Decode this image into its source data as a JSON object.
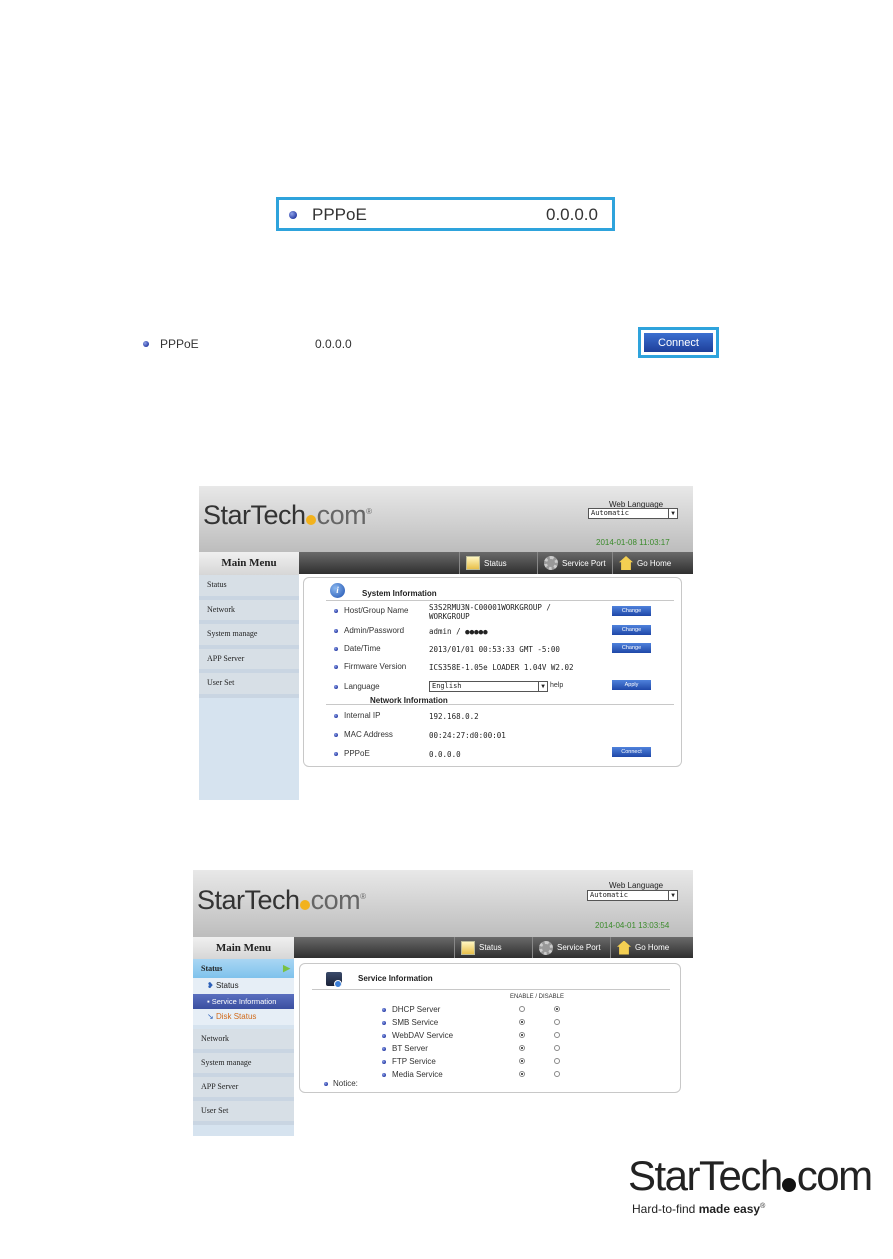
{
  "callout1": {
    "label": "PPPoE",
    "value": "0.0.0.0"
  },
  "callout2": {
    "label": "PPPoE",
    "value": "0.0.0.0",
    "button": "Connect"
  },
  "shot1": {
    "logo_main": "StarTech",
    "logo_com": "com",
    "web_language_label": "Web Language",
    "web_language_value": "Automatic",
    "datetime": "2014-01-08 11:03:17",
    "topnav": [
      "Status",
      "Service Port",
      "Go Home"
    ],
    "main_menu_title": "Main Menu",
    "main_menu": [
      "Status",
      "Network",
      "System manage",
      "APP Server",
      "User Set"
    ],
    "system_info_title": "System Information",
    "rows": [
      {
        "label": "Host/Group Name",
        "value": "S3S2RMU3N-C00001WORKGROUP / WORKGROUP",
        "button": "Change"
      },
      {
        "label": "Admin/Password",
        "value": "admin / ●●●●●",
        "button": "Change"
      },
      {
        "label": "Date/Time",
        "value": "2013/01/01 00:53:33 GMT -5:00",
        "button": "Change"
      },
      {
        "label": "Firmware Version",
        "value": "ICS358E-1.05e LOADER 1.04V W2.02",
        "button": ""
      },
      {
        "label": "Language",
        "value": "English",
        "button": "Apply",
        "suffix": "help"
      }
    ],
    "network_info_title": "Network Information",
    "net_rows": [
      {
        "label": "Internal IP",
        "value": "192.168.0.2",
        "button": ""
      },
      {
        "label": "MAC Address",
        "value": "00:24:27:d0:00:01",
        "button": ""
      },
      {
        "label": "PPPoE",
        "value": "0.0.0.0",
        "button": "Connect"
      }
    ]
  },
  "shot2": {
    "logo_main": "StarTech",
    "logo_com": "com",
    "web_language_label": "Web Language",
    "web_language_value": "Automatic",
    "datetime": "2014-04-01 13:03:54",
    "topnav": [
      "Status",
      "Service Port",
      "Go Home"
    ],
    "main_menu_title": "Main Menu",
    "status_header": "Status",
    "status_sub": [
      "Status",
      "Service Information",
      "Disk Status"
    ],
    "main_menu": [
      "Network",
      "System manage",
      "APP Server",
      "User Set"
    ],
    "service_title": "Service Information",
    "enable_disable": "ENABLE / DISABLE",
    "services": [
      {
        "name": "DHCP Server",
        "enabled": false
      },
      {
        "name": "SMB Service",
        "enabled": true
      },
      {
        "name": "WebDAV Service",
        "enabled": true
      },
      {
        "name": "BT Server",
        "enabled": true
      },
      {
        "name": "FTP Service",
        "enabled": true
      },
      {
        "name": "Media Service",
        "enabled": true
      }
    ],
    "notice": "Notice:"
  },
  "brand": {
    "logo_main": "StarTech",
    "logo_com": "com",
    "tag_plain": "Hard-to-find ",
    "tag_bold": "made easy",
    "reg": "®"
  }
}
